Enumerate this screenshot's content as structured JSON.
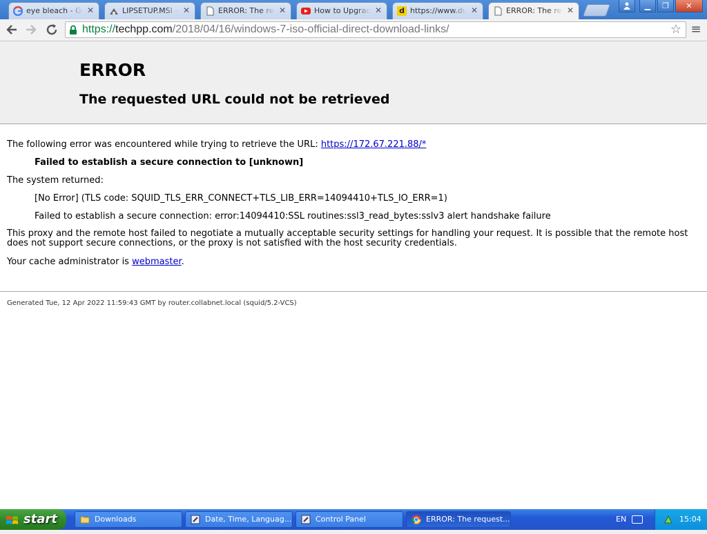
{
  "tabs": [
    {
      "title": "eye bleach - Goo",
      "icon": "google-icon"
    },
    {
      "title": "LIPSETUP.MSI - A",
      "icon": "archive-icon"
    },
    {
      "title": "ERROR: The requ",
      "icon": "page-icon"
    },
    {
      "title": "How to Upgrade",
      "icon": "youtube-icon"
    },
    {
      "title": "https://www.dum",
      "icon": "d-site-icon"
    },
    {
      "title": "ERROR: The requ",
      "icon": "page-icon"
    }
  ],
  "toolbar": {
    "url_scheme": "https://",
    "url_host": "techpp.com",
    "url_path": "/2018/04/16/windows-7-iso-official-direct-download-links/"
  },
  "page": {
    "heading": "ERROR",
    "subheading": "The requested URL could not be retrieved",
    "intro": "The following error was encountered while trying to retrieve the URL: ",
    "error_url": "https://172.67.221.88/*",
    "failure": "Failed to establish a secure connection to [unknown]",
    "system_returned": "The system returned:",
    "tls_code": "[No Error] (TLS code: SQUID_TLS_ERR_CONNECT+TLS_LIB_ERR=14094410+TLS_IO_ERR=1)",
    "ssl_error": "Failed to establish a secure connection: error:14094410:SSL routines:ssl3_read_bytes:sslv3 alert handshake failure",
    "explanation": "This proxy and the remote host failed to negotiate a mutually acceptable security settings for handling your request. It is possible that the remote host does not support secure connections, or the proxy is not satisfied with the host security credentials.",
    "admin_prefix": "Your cache administrator is ",
    "admin_link": "webmaster",
    "admin_suffix": ".",
    "footer": "Generated Tue, 12 Apr 2022 11:59:43 GMT by router.collabnet.local (squid/5.2-VCS)"
  },
  "taskbar": {
    "start_label": "start",
    "tasks": [
      {
        "label": "Downloads",
        "icon": "folder-icon"
      },
      {
        "label": "Date, Time, Languag...",
        "icon": "control-panel-icon"
      },
      {
        "label": "Control Panel",
        "icon": "control-panel-icon"
      },
      {
        "label": "ERROR: The request...",
        "icon": "chrome-icon"
      }
    ],
    "language": "EN",
    "clock": "15:04"
  },
  "colors": {
    "link": "#0000cc",
    "secure_scheme": "#0b8043",
    "taskbar": "#2459d6",
    "start_button": "#2f8a2a"
  }
}
